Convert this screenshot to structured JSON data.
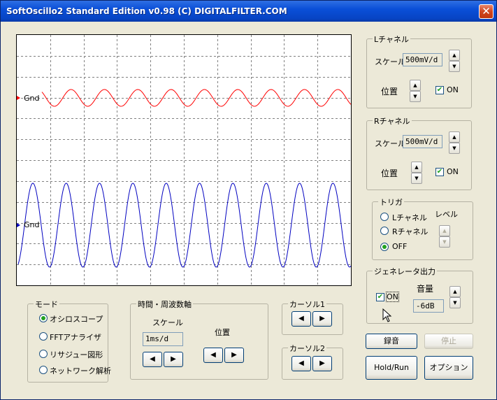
{
  "window": {
    "title": "SoftOscillo2 Standard Edition v0.98 (C) DIGITALFILTER.COM",
    "close_glyph": "✕"
  },
  "scope": {
    "gnd_left": "Gnd",
    "gnd_right": "Gnd",
    "left_color": "#ff0000",
    "right_color": "#0000c0"
  },
  "lch": {
    "title": "Lチャネル",
    "scale_label": "スケール",
    "scale_value": "500mV/d",
    "position_label": "位置",
    "on_label": "ON",
    "on": true
  },
  "rch": {
    "title": "Rチャネル",
    "scale_label": "スケール",
    "scale_value": "500mV/d",
    "position_label": "位置",
    "on_label": "ON",
    "on": true
  },
  "trigger": {
    "title": "トリガ",
    "options": [
      "Lチャネル",
      "Rチャネル",
      "OFF"
    ],
    "selected": "OFF",
    "level_label": "レベル"
  },
  "generator": {
    "title": "ジェネレータ出力",
    "on_label": "ON",
    "on": true,
    "volume_label": "音量",
    "volume_value": "-6dB"
  },
  "mode": {
    "title": "モード",
    "options": [
      "オシロスコープ",
      "FFTアナライザ",
      "リサジュー図形",
      "ネットワーク解析"
    ],
    "selected": "オシロスコープ"
  },
  "timebase": {
    "title": "時間・周波数軸",
    "scale_label": "スケール",
    "scale_value": "1ms/d",
    "position_label": "位置"
  },
  "cursor1": {
    "title": "カーソル1"
  },
  "cursor2": {
    "title": "カーソル2"
  },
  "buttons": {
    "record": "録音",
    "stop": "停止",
    "hold_run": "Hold/Run",
    "options": "オプション"
  },
  "glyphs": {
    "left": "◀",
    "right": "▶",
    "up": "▲",
    "down": "▼"
  }
}
